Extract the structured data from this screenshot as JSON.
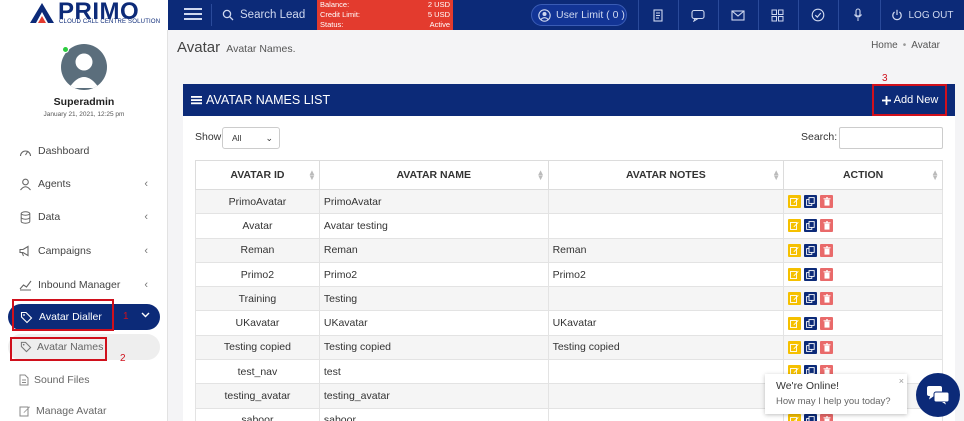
{
  "brand": {
    "name": "PRIMO",
    "tagline": "CLOUD CALL CENTRE SOLUTION"
  },
  "topbar": {
    "search_label": "Search Lead",
    "balance_rows": [
      {
        "label": "Balance:",
        "value": "2 USD"
      },
      {
        "label": "Credit Limit:",
        "value": "5 USD"
      },
      {
        "label": "Status:",
        "value": "Active"
      }
    ],
    "user_limit": "User Limit ( 0 )",
    "icons": [
      "document-icon",
      "chat-icon",
      "mail-icon",
      "grid-icon",
      "check-icon",
      "microphone-icon"
    ],
    "logout": "LOG OUT"
  },
  "user": {
    "name": "Superadmin",
    "datetime": "January 21, 2021, 12:25 pm"
  },
  "sidebar": {
    "items": [
      {
        "label": "Dashboard"
      },
      {
        "label": "Agents"
      },
      {
        "label": "Data"
      },
      {
        "label": "Campaigns"
      },
      {
        "label": "Inbound Manager"
      },
      {
        "label": "Avatar Dialler"
      }
    ],
    "sub_items": [
      {
        "label": "Avatar Names"
      },
      {
        "label": "Sound Files"
      },
      {
        "label": "Manage Avatar"
      }
    ]
  },
  "annotations": {
    "n1": "1",
    "n2": "2",
    "n3": "3"
  },
  "page": {
    "title": "Avatar",
    "subtitle": "Avatar Names.",
    "breadcrumb": [
      "Home",
      "Avatar"
    ]
  },
  "panel": {
    "title": "AVATAR NAMES LIST",
    "add_button": "Add New",
    "show_label": "Show",
    "show_value": "All",
    "search_label": "Search:",
    "columns": [
      "AVATAR ID",
      "AVATAR NAME",
      "AVATAR NOTES",
      "ACTION"
    ],
    "rows": [
      {
        "id": "PrimoAvatar",
        "name": "PrimoAvatar",
        "notes": ""
      },
      {
        "id": "Avatar",
        "name": "Avatar testing",
        "notes": ""
      },
      {
        "id": "Reman",
        "name": "Reman",
        "notes": "Reman"
      },
      {
        "id": "Primo2",
        "name": "Primo2",
        "notes": "Primo2"
      },
      {
        "id": "Training",
        "name": "Testing",
        "notes": ""
      },
      {
        "id": "UKavatar",
        "name": "UKavatar",
        "notes": "UKavatar"
      },
      {
        "id": "Testing copied",
        "name": "Testing copied",
        "notes": "Testing copied"
      },
      {
        "id": "test_nav",
        "name": "test",
        "notes": ""
      },
      {
        "id": "testing_avatar",
        "name": "testing_avatar",
        "notes": ""
      },
      {
        "id": "saboor",
        "name": "saboor",
        "notes": ""
      }
    ]
  },
  "chat": {
    "line1": "We're Online!",
    "line2": "How may I help you today?"
  },
  "colors": {
    "navy": "#0c2a78",
    "red": "#e33b2e",
    "edit": "#f5c000",
    "delete": "#e96a6a",
    "annotation": "#d0101c"
  }
}
